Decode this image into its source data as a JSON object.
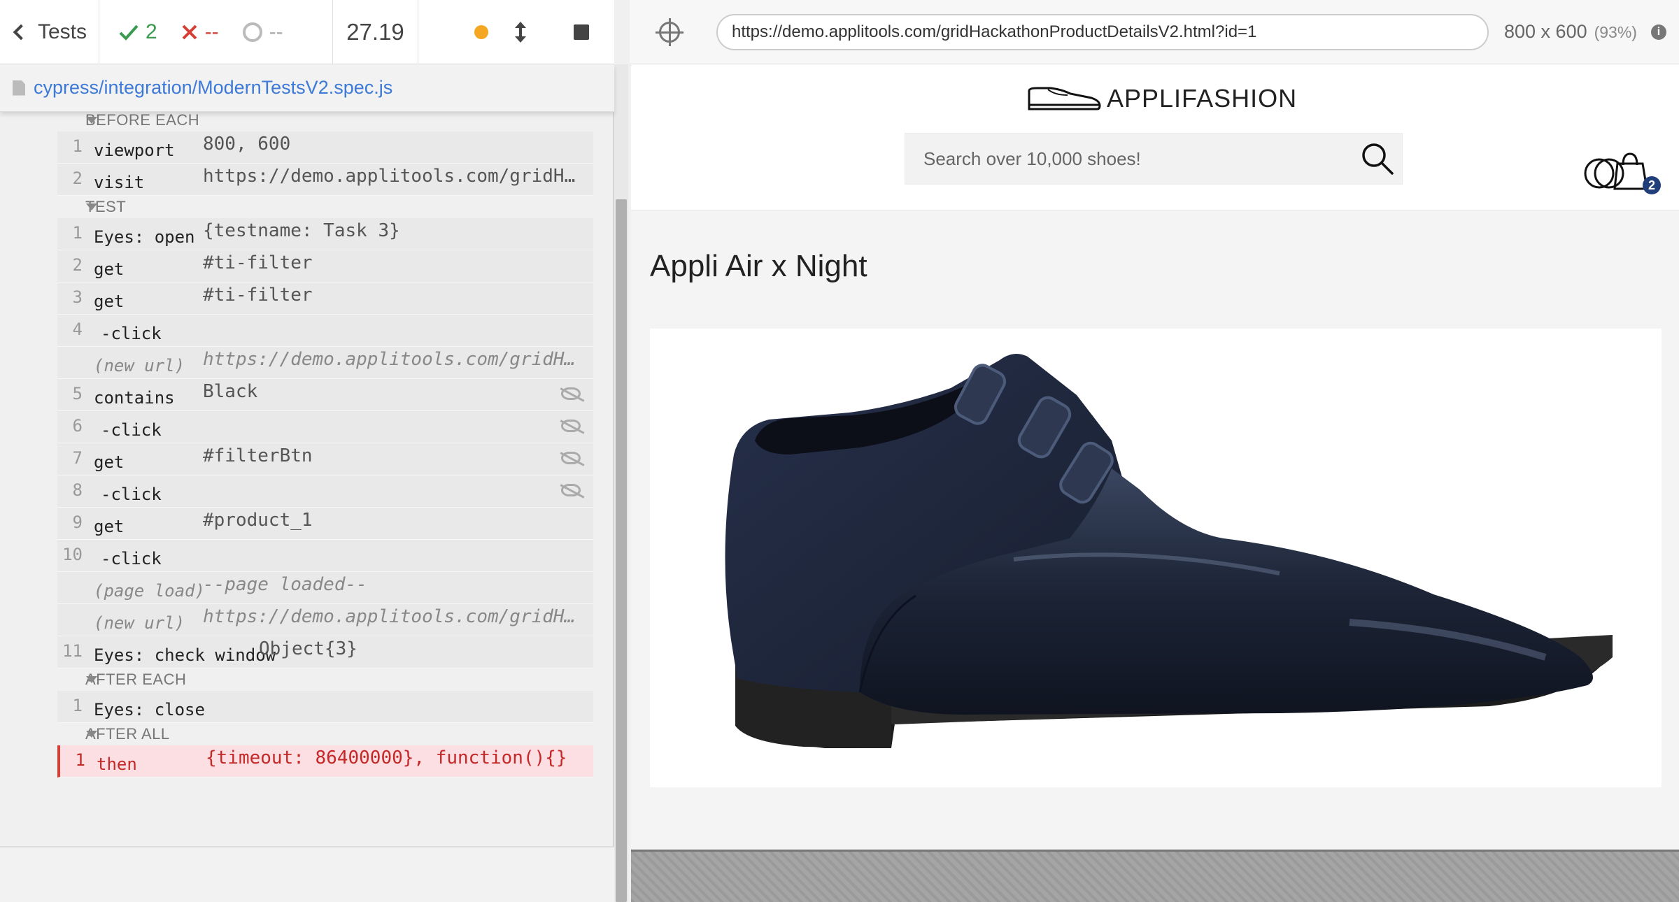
{
  "reporter": {
    "tests_label": "Tests",
    "passed": "2",
    "failed": "--",
    "pending": "--",
    "duration": "27.19"
  },
  "spec": {
    "path": "cypress/integration/ModernTestsV2.spec.js"
  },
  "commands": {
    "before_each": {
      "title": "BEFORE EACH",
      "rows": [
        {
          "num": "1",
          "name": "viewport",
          "msg": "800, 600"
        },
        {
          "num": "2",
          "name": "visit",
          "msg": "https://demo.applitools.com/gridHack…"
        }
      ]
    },
    "test": {
      "title": "TEST",
      "rows": [
        {
          "num": "1",
          "name": "Eyes: open",
          "msg": "{testname: Task 3}"
        },
        {
          "num": "2",
          "name": "get",
          "msg": "#ti-filter"
        },
        {
          "num": "3",
          "name": "get",
          "msg": "#ti-filter"
        },
        {
          "num": "4",
          "name": "-click",
          "msg": ""
        },
        {
          "num": "",
          "name": "(new url)",
          "msg": "https://demo.applitools.com/gridHack…"
        },
        {
          "num": "5",
          "name": "contains",
          "msg": "Black"
        },
        {
          "num": "6",
          "name": "-click",
          "msg": ""
        },
        {
          "num": "7",
          "name": "get",
          "msg": "#filterBtn"
        },
        {
          "num": "8",
          "name": "-click",
          "msg": ""
        },
        {
          "num": "9",
          "name": "get",
          "msg": "#product_1"
        },
        {
          "num": "10",
          "name": "-click",
          "msg": ""
        },
        {
          "num": "",
          "name": "(page load)",
          "msg": "--page loaded--"
        },
        {
          "num": "",
          "name": "(new url)",
          "msg": "https://demo.applitools.com/gridHack…"
        },
        {
          "num": "11",
          "name": "Eyes: check window",
          "msg": "Object{3}"
        }
      ]
    },
    "after_each": {
      "title": "AFTER EACH",
      "rows": [
        {
          "num": "1",
          "name": "Eyes: close",
          "msg": ""
        }
      ]
    },
    "after_all": {
      "title": "AFTER ALL",
      "rows": [
        {
          "num": "1",
          "name": "then",
          "msg": "{timeout: 86400000}, function(){}"
        }
      ]
    }
  },
  "aut": {
    "url": "https://demo.applitools.com/gridHackathonProductDetailsV2.html?id=1",
    "viewport": "800 x 600",
    "scale": "(93%)",
    "info_icon": "i"
  },
  "site": {
    "logo_text": "APPLIFASHION",
    "search_placeholder": "Search over 10,000 shoes!",
    "cart_count": "2",
    "product_title": "Appli Air x Night"
  },
  "icons": {
    "back": "chevron-left-icon",
    "passed": "check-icon",
    "failed": "x-icon",
    "pending": "ring-icon",
    "status": "orange-dot-icon",
    "resize": "up-down-arrows-icon",
    "stop": "stop-icon",
    "file": "file-icon",
    "selector": "crosshair-icon",
    "hidden": "eye-slash-icon",
    "search": "search-icon",
    "cart": "cart-icon"
  },
  "colors": {
    "pass": "#3a9a4f",
    "fail": "#d43f36",
    "link": "#3d7ad8",
    "failed_row_bg": "#fbdfe2",
    "status_dot": "#f5a623",
    "cart_badge": "#1f3e7a"
  }
}
